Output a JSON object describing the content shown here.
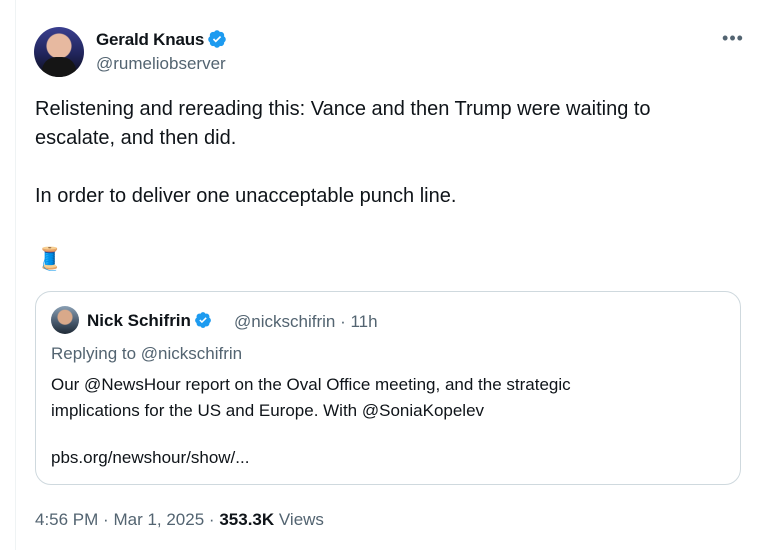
{
  "tweet": {
    "author_name": "Gerald Knaus",
    "author_handle": "@rumeliobserver",
    "more_icon": "more-horizontal-icon",
    "verified_icon": "verified-badge-icon",
    "text": "Relistening and rereading this: Vance and then Trump were waiting to\nescalate, and then did.\n\nIn order to deliver one unacceptable punch line.",
    "emoji": "🧵"
  },
  "quote": {
    "author_name": "Nick Schifrin",
    "author_handle": "@nickschifrin",
    "separator": "·",
    "age": "11h",
    "replying_to": "Replying to @nickschifrin",
    "text": "Our @NewsHour report on the Oval Office meeting, and the strategic\nimplications for the US and Europe. With @SoniaKopelev",
    "link": "pbs.org/newshour/show/..."
  },
  "footer": {
    "time": "4:56 PM",
    "dot1": "·",
    "date": "Mar 1, 2025",
    "dot2": "·",
    "views_count": "353.3K",
    "views_label": "Views"
  },
  "colors": {
    "verified": "#1d9bf0",
    "secondary_text": "#536471",
    "primary_text": "#0f1419",
    "border": "#cfd9de"
  }
}
